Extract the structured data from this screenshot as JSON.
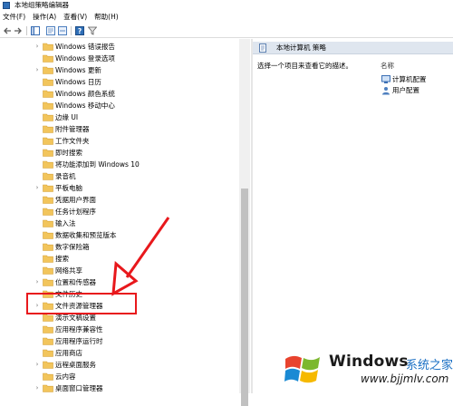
{
  "window": {
    "title": "本地组策略编辑器"
  },
  "menubar": [
    "文件(F)",
    "操作(A)",
    "查看(V)",
    "帮助(H)"
  ],
  "toolbar": {
    "icons": [
      "back-arrow-icon",
      "forward-arrow-icon",
      "console-tree-icon",
      "properties-icon",
      "export-list-icon",
      "help-icon",
      "filter-icon"
    ]
  },
  "tree": {
    "items": [
      {
        "label": "Windows 错误报告",
        "expandable": true
      },
      {
        "label": "Windows 登录选项",
        "expandable": false
      },
      {
        "label": "Windows 更新",
        "expandable": true
      },
      {
        "label": "Windows 日历",
        "expandable": false
      },
      {
        "label": "Windows 颜色系统",
        "expandable": false
      },
      {
        "label": "Windows 移动中心",
        "expandable": false
      },
      {
        "label": "边缘 UI",
        "expandable": false
      },
      {
        "label": "附件管理器",
        "expandable": false
      },
      {
        "label": "工作文件夹",
        "expandable": false
      },
      {
        "label": "即时搜索",
        "expandable": false
      },
      {
        "label": "将功能添加到 Windows 10",
        "expandable": false
      },
      {
        "label": "录音机",
        "expandable": false
      },
      {
        "label": "平板电脑",
        "expandable": true
      },
      {
        "label": "凭据用户界面",
        "expandable": false
      },
      {
        "label": "任务计划程序",
        "expandable": false
      },
      {
        "label": "输入法",
        "expandable": false
      },
      {
        "label": "数据收集和预览版本",
        "expandable": false
      },
      {
        "label": "数字保险箱",
        "expandable": false
      },
      {
        "label": "搜索",
        "expandable": false
      },
      {
        "label": "网络共享",
        "expandable": false
      },
      {
        "label": "位置和传感器",
        "expandable": true
      },
      {
        "label": "文件历史",
        "expandable": false
      },
      {
        "label": "文件资源管理器",
        "expandable": true
      },
      {
        "label": "演示文稿设置",
        "expandable": false
      },
      {
        "label": "应用程序兼容性",
        "expandable": false
      },
      {
        "label": "应用程序运行时",
        "expandable": false
      },
      {
        "label": "应用商店",
        "expandable": false
      },
      {
        "label": "远程桌面服务",
        "expandable": true
      },
      {
        "label": "云内容",
        "expandable": false
      },
      {
        "label": "桌面窗口管理器",
        "expandable": true
      }
    ]
  },
  "right_pane": {
    "header_title": "本地计算机 策略",
    "description": "选择一个项目来查看它的描述。",
    "column_header": "名称",
    "items": [
      {
        "label": "计算机配置",
        "icon": "computer-config-icon"
      },
      {
        "label": "用户配置",
        "icon": "user-config-icon"
      }
    ]
  },
  "annotation": {
    "highlight_color": "#e8181c",
    "arrow_color": "#e8181c"
  },
  "watermark": {
    "brand": "Windows",
    "brand_cn": "系统之家",
    "url": "www.bjjmlv.com",
    "colors": {
      "red": "#e8432e",
      "green": "#7cb82f",
      "blue": "#1a8ad4",
      "yellow": "#f6b900"
    }
  }
}
